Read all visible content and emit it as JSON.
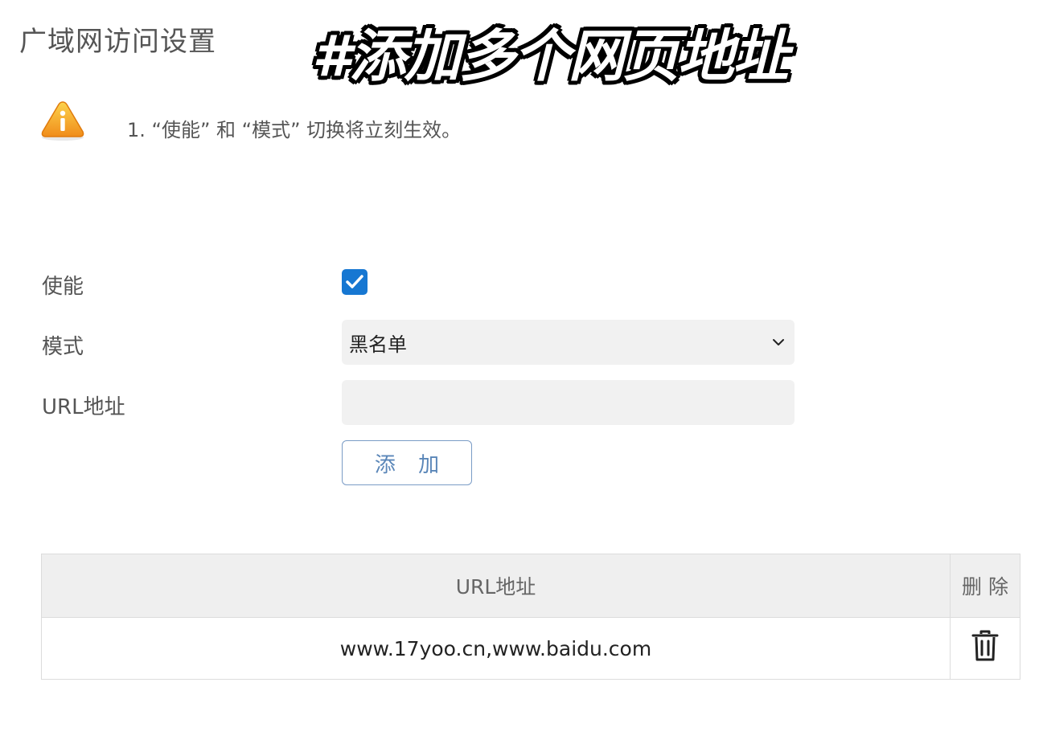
{
  "page": {
    "title": "广域网访问设置"
  },
  "overlay": {
    "caption": "#添加多个网页地址"
  },
  "notice": {
    "icon": "warning-icon",
    "text": "1. “使能” 和 “模式” 切换将立刻生效。"
  },
  "form": {
    "enable_label": "使能",
    "enable_checked": true,
    "mode_label": "模式",
    "mode_value": "黑名单",
    "url_label": "URL地址",
    "url_value": "",
    "add_button": "添 加"
  },
  "table": {
    "headers": [
      "URL地址",
      "删 除"
    ],
    "rows": [
      {
        "url": "www.17yoo.cn,www.baidu.com",
        "delete_icon": "trash-icon"
      }
    ]
  },
  "colors": {
    "accent": "#1677d2",
    "warning": "#f5a623",
    "button_text": "#5a86b8"
  }
}
